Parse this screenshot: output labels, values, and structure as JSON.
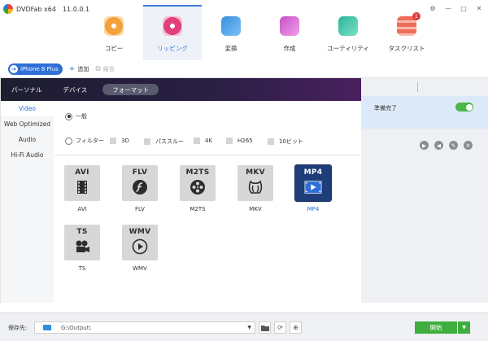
{
  "app": {
    "name": "DVDFab x64",
    "version": "11.0.0.1"
  },
  "window_controls": [
    "⚙",
    "—",
    "□",
    "✕"
  ],
  "main_tabs": [
    {
      "label": "コピー",
      "icon": "copy-disc-icon",
      "color": "#f2a23a"
    },
    {
      "label": "リッピング",
      "icon": "ripper-disc-icon",
      "color": "#e0417a",
      "active": true
    },
    {
      "label": "変換",
      "icon": "converter-film-icon",
      "color": "#3a8fe0"
    },
    {
      "label": "作成",
      "icon": "creator-icon",
      "color": "#c94fc9"
    },
    {
      "label": "ユーティリティ",
      "icon": "utility-folder-icon",
      "color": "#2bb59c"
    },
    {
      "label": "タスクリスト",
      "icon": "tasklist-icon",
      "color": "#ef6b5a",
      "badge": "1"
    }
  ],
  "subbar": {
    "device": "iPhone 8 Plus",
    "add": "追加",
    "merge": "結合"
  },
  "panel_tabs": [
    "パーソナル",
    "デバイス",
    "フォーマット"
  ],
  "side_nav": [
    "Video",
    "Web Optimized",
    "Audio",
    "Hi-Fi Audio"
  ],
  "options": {
    "general": "一般",
    "filter": "フィルター",
    "checks": [
      "3D",
      "パススルー",
      "4K",
      "H265",
      "10ビット"
    ]
  },
  "formats": [
    {
      "label": "AVI",
      "name": "AVI",
      "glyph": "film-strip-icon"
    },
    {
      "label": "FLV",
      "name": "FLV",
      "glyph": "flash-icon"
    },
    {
      "label": "M2TS",
      "name": "M2TS",
      "glyph": "film-reel-icon"
    },
    {
      "label": "MKV",
      "name": "MKV",
      "glyph": "matroska-icon"
    },
    {
      "label": "MP4",
      "name": "MP4",
      "glyph": "mp4-play-icon",
      "active": true
    },
    {
      "label": "TS",
      "name": "TS",
      "glyph": "camera-icon"
    },
    {
      "label": "WMV",
      "name": "WMV",
      "glyph": "play-circle-icon"
    }
  ],
  "right_panel": {
    "status": "準備完了",
    "toggle_on": true,
    "controls": [
      "play-icon",
      "back-icon",
      "edit-icon",
      "close-icon"
    ]
  },
  "bottom": {
    "save_label": "保存先:",
    "path": "G:\\Output\\",
    "start": "開始"
  }
}
